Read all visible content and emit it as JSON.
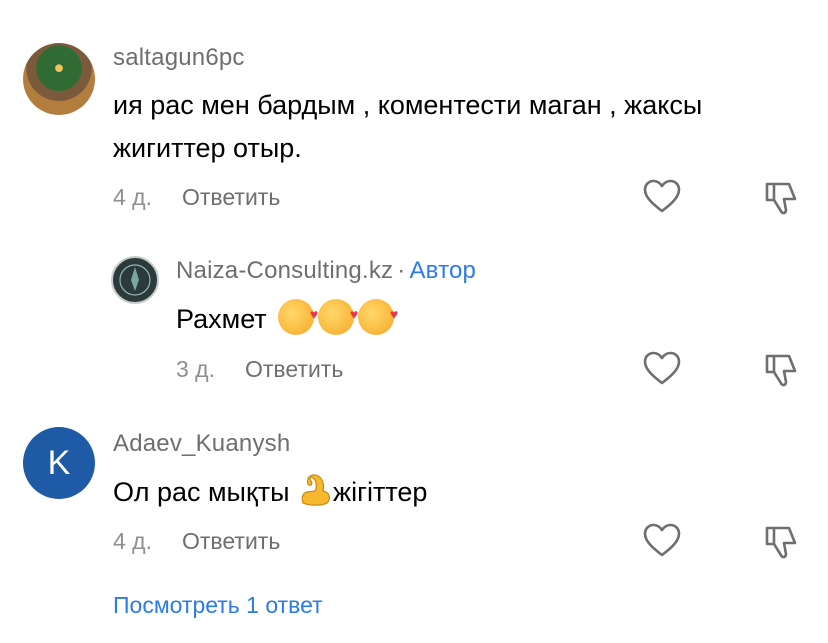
{
  "comments": [
    {
      "username": "saltagun6pc",
      "text_line1": "ия рас мен бардым , коментести маган , жаксы",
      "text_line2": "жигиттер отыр.",
      "time": "4 д.",
      "reply_label": "Ответить"
    },
    {
      "username": "Naiza-Consulting.kz",
      "badge_separator": "·",
      "badge": "Автор",
      "text": "Рахмет",
      "emoji_count": 3,
      "time": "3 д.",
      "reply_label": "Ответить"
    },
    {
      "username": "Adaev_Kuanysh",
      "avatar_letter": "K",
      "text_before": "Ол рас мықты ",
      "text_after": "жігіттер",
      "time": "4 д.",
      "reply_label": "Ответить"
    }
  ],
  "view_replies": "Посмотреть 1 ответ",
  "colors": {
    "accent": "#2d7be5",
    "avatar_k": "#1f5aa6",
    "muted": "#8e8e93"
  },
  "icons": [
    "heart-icon",
    "dislike-icon"
  ]
}
